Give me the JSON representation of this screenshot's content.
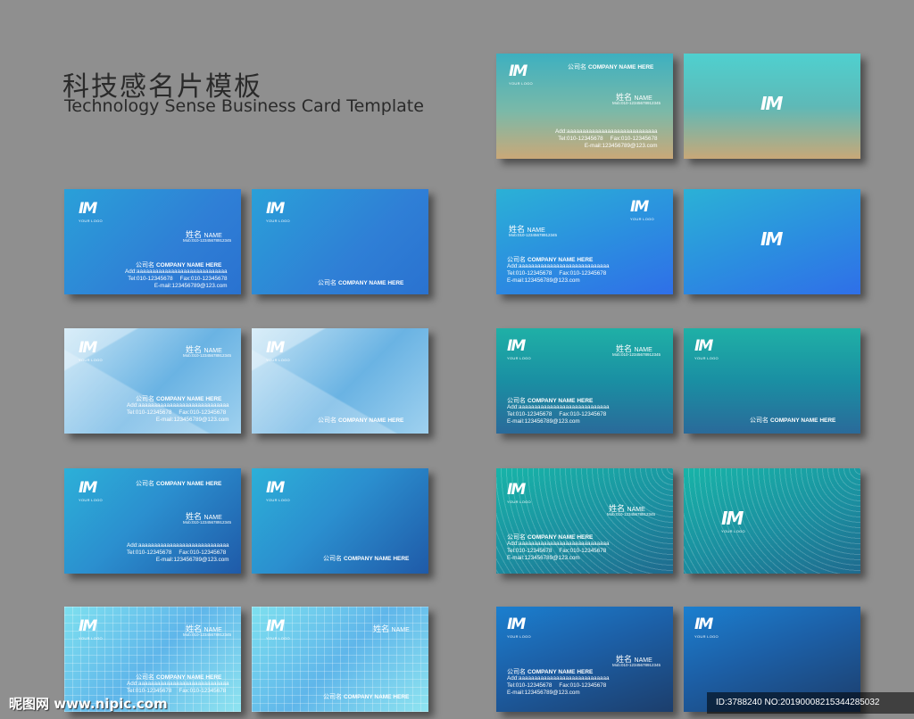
{
  "title_zh": "科技感名片模板",
  "title_en": "Technology Sense Business Card Template",
  "logo": {
    "mark": "IM",
    "sub": "YOUR LOGO"
  },
  "card": {
    "name_zh": "姓名",
    "name_en": "NAME",
    "mobile": "Mob:010-12345678912345",
    "company_zh": "公司名",
    "company_en": "COMPANY NAME HERE",
    "address": "Add:aaaaaaaaaaaaaaaaaaaaaaaaaaaaa",
    "tel": "Tel:010-12345678",
    "fax": "Fax:010-12345678",
    "email": "E-mail:123456789@123.com"
  },
  "watermark": {
    "site": "昵图网 www.nipic.com",
    "id": "ID:3788240 NO:20190008215344285032"
  }
}
